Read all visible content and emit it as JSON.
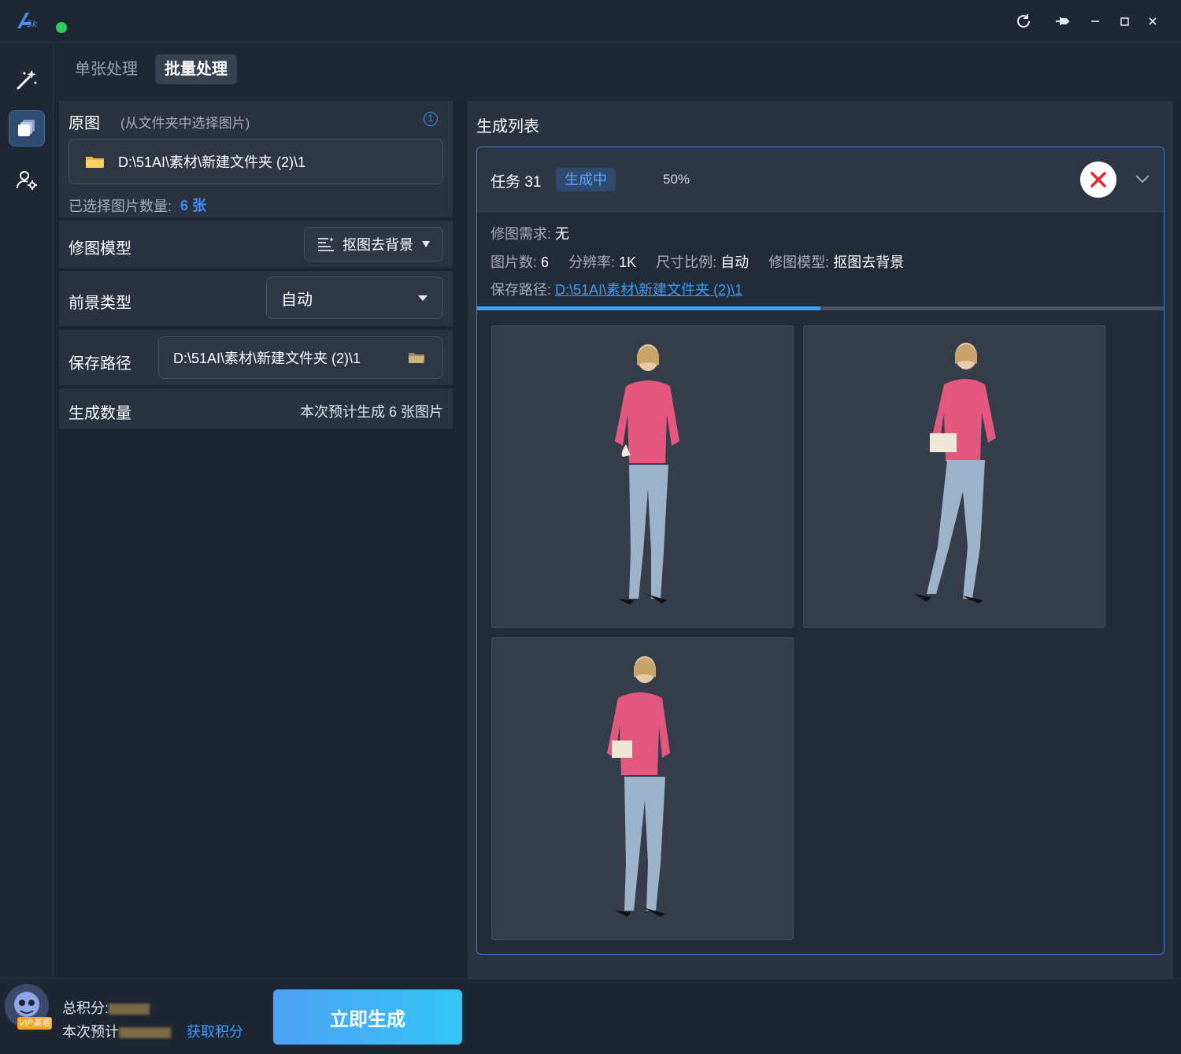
{
  "titlebar": {
    "logo": "51ai-logo",
    "controls": [
      "refresh-icon",
      "pin-icon",
      "minimize-icon",
      "maximize-icon",
      "close-icon"
    ],
    "status_color": "#2ecc5a"
  },
  "sidebar": {
    "items": [
      {
        "icon": "magic-wand-icon",
        "active": false
      },
      {
        "icon": "image-stack-icon",
        "active": true
      },
      {
        "icon": "user-settings-icon",
        "active": false
      }
    ]
  },
  "tabs": [
    {
      "label": "单张处理",
      "active": false
    },
    {
      "label": "批量处理",
      "active": true
    }
  ],
  "source": {
    "title": "原图",
    "hint": "(从文件夹中选择图片)",
    "info_icon": "①",
    "path": "D:\\51AI\\素材\\新建文件夹 (2)\\1",
    "count_label": "已选择图片数量:",
    "count_value": "6 张"
  },
  "model": {
    "label": "修图模型",
    "value": "抠图去背景"
  },
  "foreground": {
    "label": "前景类型",
    "value": "自动"
  },
  "save": {
    "label": "保存路径",
    "path": "D:\\51AI\\素材\\新建文件夹 (2)\\1"
  },
  "quantity": {
    "label": "生成数量",
    "value": "本次预计生成 6 张图片"
  },
  "list": {
    "title": "生成列表",
    "task": {
      "name": "任务 31",
      "status": "生成中",
      "percent": "50%",
      "progress": 0.5,
      "requirement_label": "修图需求:",
      "requirement_value": "无",
      "count_label": "图片数:",
      "count_value": "6",
      "resolution_label": "分辨率:",
      "resolution_value": "1K",
      "ratio_label": "尺寸比例:",
      "ratio_value": "自动",
      "model_label": "修图模型:",
      "model_value": "抠图去背景",
      "path_label": "保存路径:",
      "path_value": "D:\\51AI\\素材\\新建文件夹 (2)\\1"
    }
  },
  "bottom": {
    "total_points_label": "总积分:",
    "estimate_label": "本次预计",
    "get_points": "获取积分",
    "vip_badge": "VIP蒸粗",
    "generate": "立即生成"
  }
}
